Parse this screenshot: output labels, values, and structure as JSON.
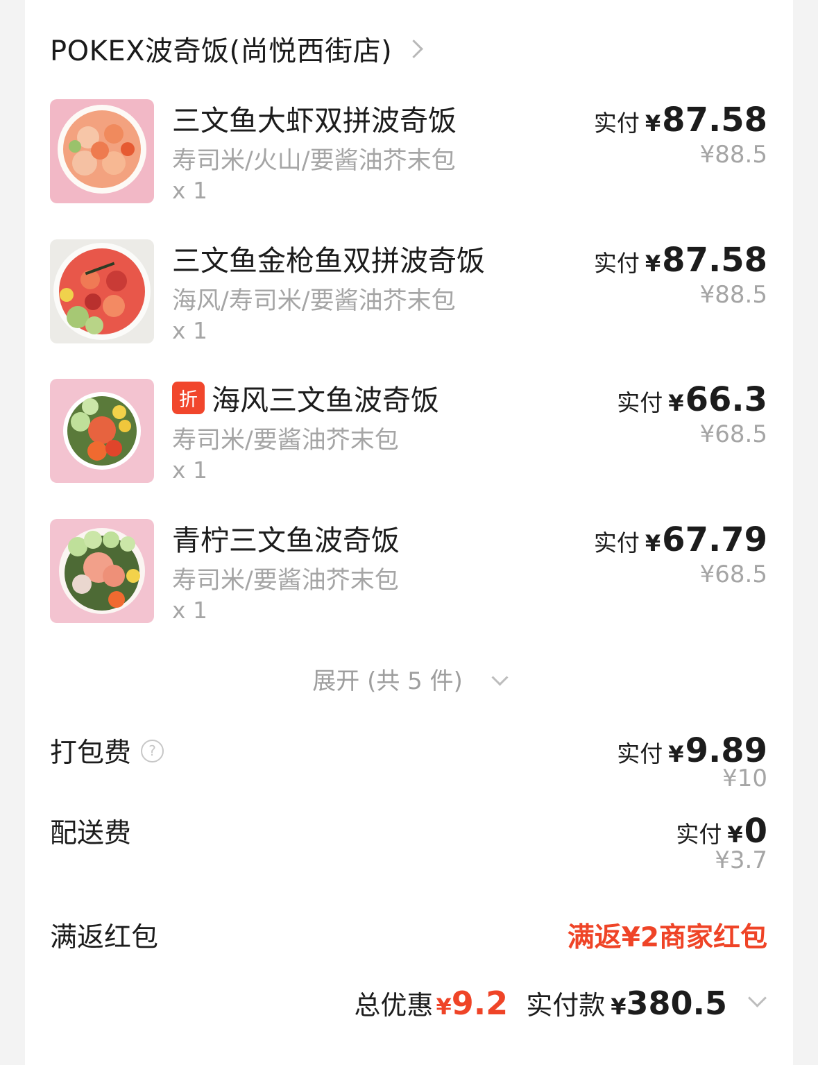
{
  "shop": {
    "name": "POKEX波奇饭(尚悦西街店)"
  },
  "items": [
    {
      "name": "三文鱼大虾双拼波奇饭",
      "tag": "",
      "spec": "寿司米/火山/要酱油芥末包",
      "qty": "x 1",
      "paid_label": "实付",
      "currency": "¥",
      "paid": "87.58",
      "original": "¥88.5",
      "image": "shrimp-salmon-bowl"
    },
    {
      "name": "三文鱼金枪鱼双拼波奇饭",
      "tag": "",
      "spec": "海风/寿司米/要酱油芥末包",
      "qty": "x 1",
      "paid_label": "实付",
      "currency": "¥",
      "paid": "87.58",
      "original": "¥88.5",
      "image": "salmon-tuna-bowl"
    },
    {
      "name": "海风三文鱼波奇饭",
      "tag": "折",
      "spec": "寿司米/要酱油芥末包",
      "qty": "x 1",
      "paid_label": "实付",
      "currency": "¥",
      "paid": "66.3",
      "original": "¥68.5",
      "image": "salmon-bowl"
    },
    {
      "name": "青柠三文鱼波奇饭",
      "tag": "",
      "spec": "寿司米/要酱油芥末包",
      "qty": "x 1",
      "paid_label": "实付",
      "currency": "¥",
      "paid": "67.79",
      "original": "¥68.5",
      "image": "lime-salmon-bowl"
    }
  ],
  "expand": {
    "label": "展开 (共 5 件)"
  },
  "packaging": {
    "title": "打包费",
    "paid_label": "实付",
    "currency": "¥",
    "paid": "9.89",
    "original": "¥10"
  },
  "delivery": {
    "title": "配送费",
    "paid_label": "实付",
    "currency": "¥",
    "paid": "0",
    "original": "¥3.7"
  },
  "rebate": {
    "title": "满返红包",
    "value": "满返¥2商家红包"
  },
  "summary": {
    "discount_label": "总优惠",
    "discount_currency": "¥",
    "discount": "9.2",
    "pay_label": "实付款",
    "pay_currency": "¥",
    "pay": "380.5"
  },
  "colors": {
    "accent": "#ef4427",
    "muted": "#a5a5a5",
    "background": "#f3f3f3"
  }
}
